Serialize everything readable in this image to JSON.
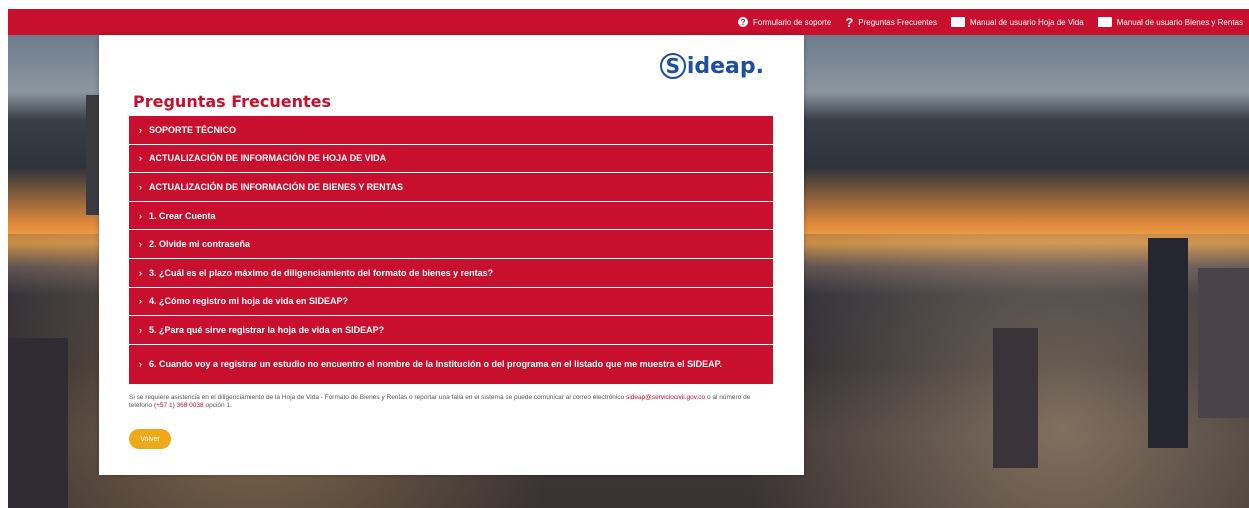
{
  "topbar": {
    "links": [
      {
        "label": "Formulario de soporte",
        "icon": "help-circle-icon"
      },
      {
        "label": "Preguntas Frecuentes",
        "icon": "question-mark-icon"
      },
      {
        "label": "Manual de usuario Hoja de Vida",
        "icon": "book-icon"
      },
      {
        "label": "Manual de usuario Bienes y Rentas",
        "icon": "book-icon"
      }
    ],
    "color": "#c8102e"
  },
  "logo": {
    "ring_letter": "S",
    "rest": "ideap."
  },
  "page": {
    "title": "Preguntas Frecuentes"
  },
  "faq": {
    "items": [
      {
        "label": "SOPORTE TÉCNICO"
      },
      {
        "label": "ACTUALIZACIÓN DE INFORMACIÓN DE HOJA DE VIDA"
      },
      {
        "label": "ACTUALIZACIÓN DE INFORMACIÓN DE BIENES Y RENTAS"
      },
      {
        "label": "1. Crear Cuenta"
      },
      {
        "label": "2. Olvide mi contraseña"
      },
      {
        "label": "3. ¿Cuál es el plazo máximo de diligenciamiento del formato de bienes y rentas?"
      },
      {
        "label": "4. ¿Cómo registro mi hoja de vida en SIDEAP?"
      },
      {
        "label": "5. ¿Para qué sirve registrar la hoja de vida en SIDEAP?"
      },
      {
        "label": "6. Cuando voy a registrar un estudio no encuentro el nombre de la Institución o del programa en el listado que me muestra el SIDEAP."
      }
    ],
    "chevron": "›"
  },
  "note": {
    "text1": "Si se requiere asistencia en el diligenciamiento de la Hoja de Vida - Formato de Bienes y Rentas o reportar una falla en el sistema se puede comunicar al correo electrónico",
    "email": "sideap@serviciocivil.gov.co",
    "text2": "o al número de teléfono",
    "phone": "(+57 1) 368 0038",
    "text3": "opción 1."
  },
  "buttons": {
    "back": "Volver"
  },
  "colors": {
    "accent": "#c8102e",
    "button": "#f0a81b",
    "logo": "#1f4e9c"
  }
}
